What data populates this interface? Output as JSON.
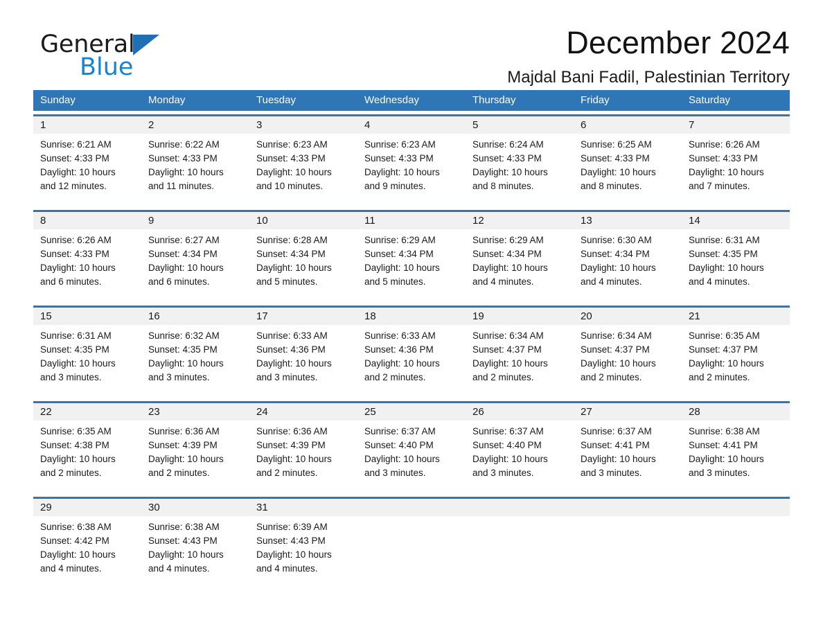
{
  "brand": {
    "name_part1": "General",
    "name_part2": "Blue",
    "triangle_color": "#1f6fb5",
    "blue_color": "#1683d3"
  },
  "header": {
    "title": "December 2024",
    "location": "Majdal Bani Fadil, Palestinian Territory"
  },
  "theme": {
    "header_blue": "#2e76b6",
    "row_rule_blue": "#2e76b6",
    "daynum_band": "#f1f1f1",
    "page_background": "#ffffff"
  },
  "calendar": {
    "weekdays": [
      "Sunday",
      "Monday",
      "Tuesday",
      "Wednesday",
      "Thursday",
      "Friday",
      "Saturday"
    ],
    "weeks": [
      {
        "days": [
          {
            "num": "1",
            "sunrise": "Sunrise: 6:21 AM",
            "sunset": "Sunset: 4:33 PM",
            "daylight1": "Daylight: 10 hours",
            "daylight2": "and 12 minutes."
          },
          {
            "num": "2",
            "sunrise": "Sunrise: 6:22 AM",
            "sunset": "Sunset: 4:33 PM",
            "daylight1": "Daylight: 10 hours",
            "daylight2": "and 11 minutes."
          },
          {
            "num": "3",
            "sunrise": "Sunrise: 6:23 AM",
            "sunset": "Sunset: 4:33 PM",
            "daylight1": "Daylight: 10 hours",
            "daylight2": "and 10 minutes."
          },
          {
            "num": "4",
            "sunrise": "Sunrise: 6:23 AM",
            "sunset": "Sunset: 4:33 PM",
            "daylight1": "Daylight: 10 hours",
            "daylight2": "and 9 minutes."
          },
          {
            "num": "5",
            "sunrise": "Sunrise: 6:24 AM",
            "sunset": "Sunset: 4:33 PM",
            "daylight1": "Daylight: 10 hours",
            "daylight2": "and 8 minutes."
          },
          {
            "num": "6",
            "sunrise": "Sunrise: 6:25 AM",
            "sunset": "Sunset: 4:33 PM",
            "daylight1": "Daylight: 10 hours",
            "daylight2": "and 8 minutes."
          },
          {
            "num": "7",
            "sunrise": "Sunrise: 6:26 AM",
            "sunset": "Sunset: 4:33 PM",
            "daylight1": "Daylight: 10 hours",
            "daylight2": "and 7 minutes."
          }
        ]
      },
      {
        "days": [
          {
            "num": "8",
            "sunrise": "Sunrise: 6:26 AM",
            "sunset": "Sunset: 4:33 PM",
            "daylight1": "Daylight: 10 hours",
            "daylight2": "and 6 minutes."
          },
          {
            "num": "9",
            "sunrise": "Sunrise: 6:27 AM",
            "sunset": "Sunset: 4:34 PM",
            "daylight1": "Daylight: 10 hours",
            "daylight2": "and 6 minutes."
          },
          {
            "num": "10",
            "sunrise": "Sunrise: 6:28 AM",
            "sunset": "Sunset: 4:34 PM",
            "daylight1": "Daylight: 10 hours",
            "daylight2": "and 5 minutes."
          },
          {
            "num": "11",
            "sunrise": "Sunrise: 6:29 AM",
            "sunset": "Sunset: 4:34 PM",
            "daylight1": "Daylight: 10 hours",
            "daylight2": "and 5 minutes."
          },
          {
            "num": "12",
            "sunrise": "Sunrise: 6:29 AM",
            "sunset": "Sunset: 4:34 PM",
            "daylight1": "Daylight: 10 hours",
            "daylight2": "and 4 minutes."
          },
          {
            "num": "13",
            "sunrise": "Sunrise: 6:30 AM",
            "sunset": "Sunset: 4:34 PM",
            "daylight1": "Daylight: 10 hours",
            "daylight2": "and 4 minutes."
          },
          {
            "num": "14",
            "sunrise": "Sunrise: 6:31 AM",
            "sunset": "Sunset: 4:35 PM",
            "daylight1": "Daylight: 10 hours",
            "daylight2": "and 4 minutes."
          }
        ]
      },
      {
        "days": [
          {
            "num": "15",
            "sunrise": "Sunrise: 6:31 AM",
            "sunset": "Sunset: 4:35 PM",
            "daylight1": "Daylight: 10 hours",
            "daylight2": "and 3 minutes."
          },
          {
            "num": "16",
            "sunrise": "Sunrise: 6:32 AM",
            "sunset": "Sunset: 4:35 PM",
            "daylight1": "Daylight: 10 hours",
            "daylight2": "and 3 minutes."
          },
          {
            "num": "17",
            "sunrise": "Sunrise: 6:33 AM",
            "sunset": "Sunset: 4:36 PM",
            "daylight1": "Daylight: 10 hours",
            "daylight2": "and 3 minutes."
          },
          {
            "num": "18",
            "sunrise": "Sunrise: 6:33 AM",
            "sunset": "Sunset: 4:36 PM",
            "daylight1": "Daylight: 10 hours",
            "daylight2": "and 2 minutes."
          },
          {
            "num": "19",
            "sunrise": "Sunrise: 6:34 AM",
            "sunset": "Sunset: 4:37 PM",
            "daylight1": "Daylight: 10 hours",
            "daylight2": "and 2 minutes."
          },
          {
            "num": "20",
            "sunrise": "Sunrise: 6:34 AM",
            "sunset": "Sunset: 4:37 PM",
            "daylight1": "Daylight: 10 hours",
            "daylight2": "and 2 minutes."
          },
          {
            "num": "21",
            "sunrise": "Sunrise: 6:35 AM",
            "sunset": "Sunset: 4:37 PM",
            "daylight1": "Daylight: 10 hours",
            "daylight2": "and 2 minutes."
          }
        ]
      },
      {
        "days": [
          {
            "num": "22",
            "sunrise": "Sunrise: 6:35 AM",
            "sunset": "Sunset: 4:38 PM",
            "daylight1": "Daylight: 10 hours",
            "daylight2": "and 2 minutes."
          },
          {
            "num": "23",
            "sunrise": "Sunrise: 6:36 AM",
            "sunset": "Sunset: 4:39 PM",
            "daylight1": "Daylight: 10 hours",
            "daylight2": "and 2 minutes."
          },
          {
            "num": "24",
            "sunrise": "Sunrise: 6:36 AM",
            "sunset": "Sunset: 4:39 PM",
            "daylight1": "Daylight: 10 hours",
            "daylight2": "and 2 minutes."
          },
          {
            "num": "25",
            "sunrise": "Sunrise: 6:37 AM",
            "sunset": "Sunset: 4:40 PM",
            "daylight1": "Daylight: 10 hours",
            "daylight2": "and 3 minutes."
          },
          {
            "num": "26",
            "sunrise": "Sunrise: 6:37 AM",
            "sunset": "Sunset: 4:40 PM",
            "daylight1": "Daylight: 10 hours",
            "daylight2": "and 3 minutes."
          },
          {
            "num": "27",
            "sunrise": "Sunrise: 6:37 AM",
            "sunset": "Sunset: 4:41 PM",
            "daylight1": "Daylight: 10 hours",
            "daylight2": "and 3 minutes."
          },
          {
            "num": "28",
            "sunrise": "Sunrise: 6:38 AM",
            "sunset": "Sunset: 4:41 PM",
            "daylight1": "Daylight: 10 hours",
            "daylight2": "and 3 minutes."
          }
        ]
      },
      {
        "days": [
          {
            "num": "29",
            "sunrise": "Sunrise: 6:38 AM",
            "sunset": "Sunset: 4:42 PM",
            "daylight1": "Daylight: 10 hours",
            "daylight2": "and 4 minutes."
          },
          {
            "num": "30",
            "sunrise": "Sunrise: 6:38 AM",
            "sunset": "Sunset: 4:43 PM",
            "daylight1": "Daylight: 10 hours",
            "daylight2": "and 4 minutes."
          },
          {
            "num": "31",
            "sunrise": "Sunrise: 6:39 AM",
            "sunset": "Sunset: 4:43 PM",
            "daylight1": "Daylight: 10 hours",
            "daylight2": "and 4 minutes."
          },
          {
            "num": "",
            "sunrise": "",
            "sunset": "",
            "daylight1": "",
            "daylight2": ""
          },
          {
            "num": "",
            "sunrise": "",
            "sunset": "",
            "daylight1": "",
            "daylight2": ""
          },
          {
            "num": "",
            "sunrise": "",
            "sunset": "",
            "daylight1": "",
            "daylight2": ""
          },
          {
            "num": "",
            "sunrise": "",
            "sunset": "",
            "daylight1": "",
            "daylight2": ""
          }
        ]
      }
    ]
  }
}
